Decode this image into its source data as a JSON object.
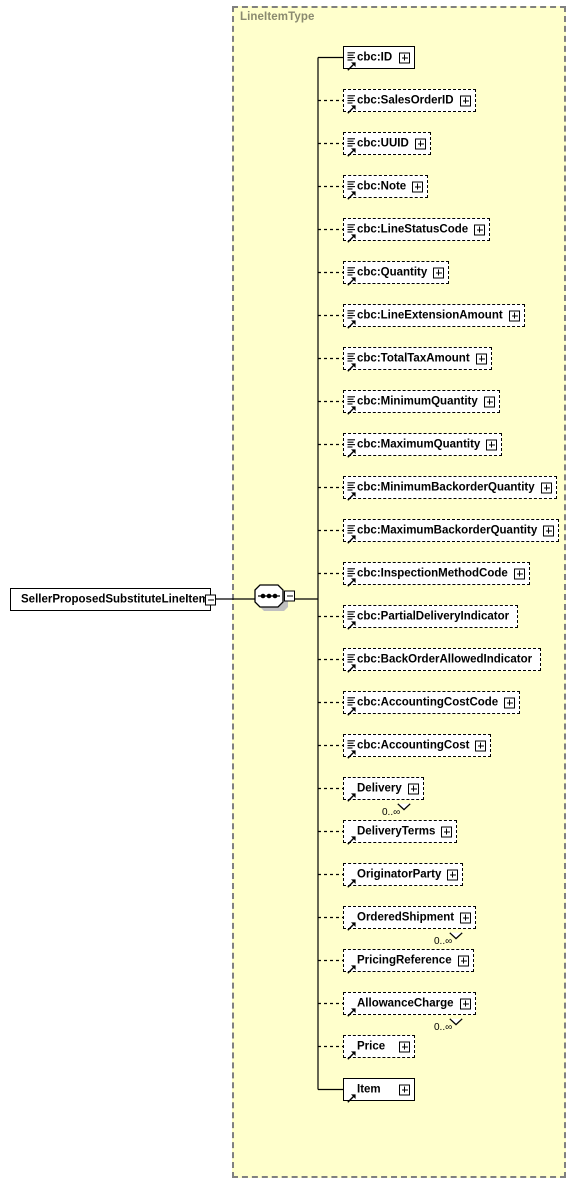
{
  "diagram": {
    "kind": "xsd-schema-diagram",
    "background_color": "#ffffff",
    "type_box_color": "#ffffcc",
    "type_box_border_color": "#808080",
    "shadow_color": "#c0c0c0"
  },
  "type_container": {
    "label": "LineItemType",
    "label_color": "#8a8a70"
  },
  "root": {
    "label": "SellerProposedSubstituteLineItem",
    "expander": "minus",
    "required": true,
    "has_attribute_glyph": false
  },
  "compositor": {
    "kind": "sequence",
    "expander": "minus"
  },
  "children": [
    {
      "label": "cbc:ID",
      "required": true,
      "expander": "plus",
      "attr_glyph": true,
      "cardinality": ""
    },
    {
      "label": "cbc:SalesOrderID",
      "required": false,
      "expander": "plus",
      "attr_glyph": true,
      "cardinality": ""
    },
    {
      "label": "cbc:UUID",
      "required": false,
      "expander": "plus",
      "attr_glyph": true,
      "cardinality": ""
    },
    {
      "label": "cbc:Note",
      "required": false,
      "expander": "plus",
      "attr_glyph": true,
      "cardinality": ""
    },
    {
      "label": "cbc:LineStatusCode",
      "required": false,
      "expander": "plus",
      "attr_glyph": true,
      "cardinality": ""
    },
    {
      "label": "cbc:Quantity",
      "required": false,
      "expander": "plus",
      "attr_glyph": true,
      "cardinality": ""
    },
    {
      "label": "cbc:LineExtensionAmount",
      "required": false,
      "expander": "plus",
      "attr_glyph": true,
      "cardinality": ""
    },
    {
      "label": "cbc:TotalTaxAmount",
      "required": false,
      "expander": "plus",
      "attr_glyph": true,
      "cardinality": ""
    },
    {
      "label": "cbc:MinimumQuantity",
      "required": false,
      "expander": "plus",
      "attr_glyph": true,
      "cardinality": ""
    },
    {
      "label": "cbc:MaximumQuantity",
      "required": false,
      "expander": "plus",
      "attr_glyph": true,
      "cardinality": ""
    },
    {
      "label": "cbc:MinimumBackorderQuantity",
      "required": false,
      "expander": "plus",
      "attr_glyph": true,
      "cardinality": ""
    },
    {
      "label": "cbc:MaximumBackorderQuantity",
      "required": false,
      "expander": "plus",
      "attr_glyph": true,
      "cardinality": ""
    },
    {
      "label": "cbc:InspectionMethodCode",
      "required": false,
      "expander": "plus",
      "attr_glyph": true,
      "cardinality": ""
    },
    {
      "label": "cbc:PartialDeliveryIndicator",
      "required": false,
      "expander": "none",
      "attr_glyph": true,
      "cardinality": ""
    },
    {
      "label": "cbc:BackOrderAllowedIndicator",
      "required": false,
      "expander": "none",
      "attr_glyph": true,
      "cardinality": ""
    },
    {
      "label": "cbc:AccountingCostCode",
      "required": false,
      "expander": "plus",
      "attr_glyph": true,
      "cardinality": ""
    },
    {
      "label": "cbc:AccountingCost",
      "required": false,
      "expander": "plus",
      "attr_glyph": true,
      "cardinality": ""
    },
    {
      "label": "Delivery",
      "required": false,
      "expander": "plus",
      "attr_glyph": false,
      "cardinality": "0..∞"
    },
    {
      "label": "DeliveryTerms",
      "required": false,
      "expander": "plus",
      "attr_glyph": false,
      "cardinality": ""
    },
    {
      "label": "OriginatorParty",
      "required": false,
      "expander": "plus",
      "attr_glyph": false,
      "cardinality": ""
    },
    {
      "label": "OrderedShipment",
      "required": false,
      "expander": "plus",
      "attr_glyph": false,
      "cardinality": "0..∞"
    },
    {
      "label": "PricingReference",
      "required": false,
      "expander": "plus",
      "attr_glyph": false,
      "cardinality": ""
    },
    {
      "label": "AllowanceCharge",
      "required": false,
      "expander": "plus",
      "attr_glyph": false,
      "cardinality": "0..∞"
    },
    {
      "label": "Price",
      "required": false,
      "expander": "plus",
      "attr_glyph": false,
      "cardinality": ""
    },
    {
      "label": "Item",
      "required": true,
      "expander": "plus",
      "attr_glyph": false,
      "cardinality": ""
    }
  ]
}
